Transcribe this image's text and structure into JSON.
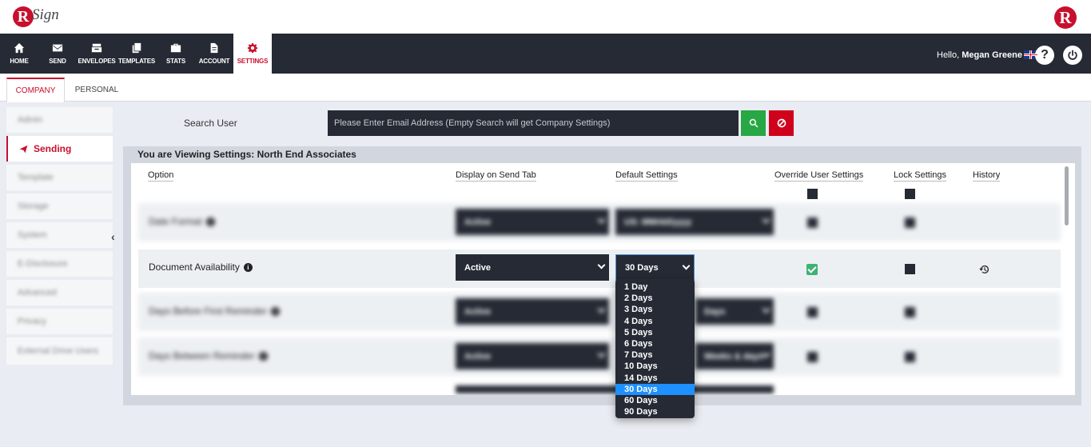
{
  "brand": {
    "logo_letter": "R",
    "logo_word": "Sign",
    "right_logo_letter": "R",
    "accent": "#c8102e",
    "nav_bg": "#252a34"
  },
  "nav": {
    "items": [
      {
        "label": "HOME",
        "icon": "home-icon"
      },
      {
        "label": "SEND",
        "icon": "envelope-icon"
      },
      {
        "label": "ENVELOPES",
        "icon": "inbox-icon"
      },
      {
        "label": "TEMPLATES",
        "icon": "copy-icon"
      },
      {
        "label": "STATS",
        "icon": "briefcase-icon"
      },
      {
        "label": "ACCOUNT",
        "icon": "document-icon"
      },
      {
        "label": "SETTINGS",
        "icon": "gear-icon",
        "active": true
      }
    ]
  },
  "user": {
    "greeting": "Hello,",
    "name": "Megan Greene",
    "help": "?",
    "power_icon": "power-icon",
    "flag": "uk-flag-icon"
  },
  "tabs": [
    {
      "label": "COMPANY",
      "active": true
    },
    {
      "label": "PERSONAL"
    }
  ],
  "sidebar": {
    "items": [
      {
        "label": "Admin"
      },
      {
        "label": "Sending",
        "active": true
      },
      {
        "label": "Template"
      },
      {
        "label": "Storage"
      },
      {
        "label": "System"
      },
      {
        "label": "E-Disclosure"
      },
      {
        "label": "Advanced"
      },
      {
        "label": "Privacy"
      },
      {
        "label": "External Drive Users"
      }
    ]
  },
  "search": {
    "label": "Search User",
    "placeholder": "Please Enter Email Address (Empty Search will get Company Settings)"
  },
  "panel": {
    "title": "You are Viewing Settings: North End Associates"
  },
  "table": {
    "headers": {
      "option": "Option",
      "display": "Display on Send Tab",
      "default": "Default Settings",
      "override": "Override User Settings",
      "lock": "Lock Settings",
      "history": "History"
    },
    "rows": [
      {
        "option": "Date Format",
        "display": "Active",
        "default": "US: MM/dd/yyyy",
        "blurred": true
      },
      {
        "option": "Document Availability",
        "display": "Active",
        "default": "30 Days",
        "override_checked": true,
        "lock_checked": false,
        "blurred": false
      },
      {
        "option": "Days Before First Reminder",
        "display": "Active",
        "default": "Days",
        "blurred": true
      },
      {
        "option": "Days Between Reminder",
        "display": "Active",
        "default": "Weeks & days",
        "blurred": true
      }
    ]
  },
  "dropdown": {
    "options": [
      "1 Day",
      "2 Days",
      "3 Days",
      "4 Days",
      "5 Days",
      "6 Days",
      "7 Days",
      "10 Days",
      "14 Days",
      "30 Days",
      "60 Days",
      "90 Days"
    ],
    "selected": "30 Days",
    "highlight": "#1e90ff"
  }
}
